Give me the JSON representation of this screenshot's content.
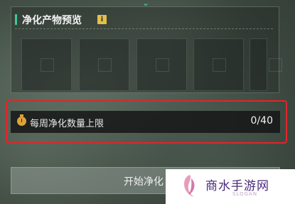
{
  "preview": {
    "title": "净化产物预览",
    "info_icon": "i",
    "slots": 5
  },
  "weekly_limit": {
    "icon": "stopwatch-icon",
    "label": "每周净化数量上限",
    "value": "0/40"
  },
  "start_button": {
    "label": "开始净化"
  },
  "watermark": {
    "name": "商水手游网",
    "slogan": "SLOGAN"
  },
  "colors": {
    "accent": "#3fc99a",
    "highlight": "#e0252b",
    "timer": "#e0a338",
    "info": "#e3c04a"
  }
}
